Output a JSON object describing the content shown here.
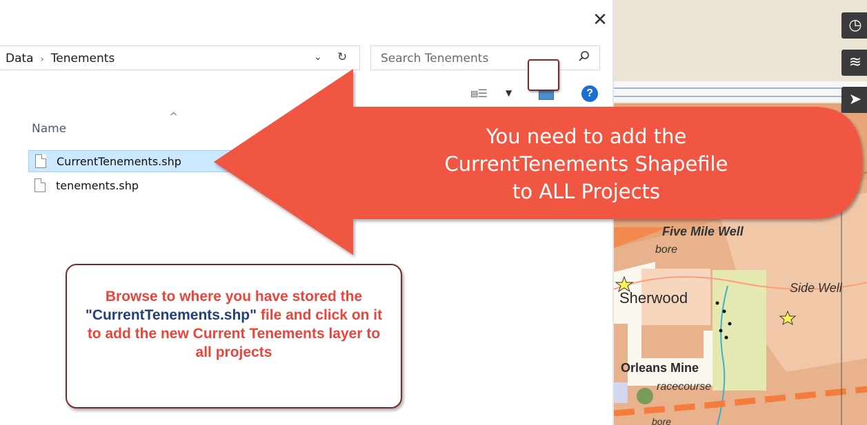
{
  "dialog": {
    "close_glyph": "✕",
    "breadcrumb": {
      "items": [
        "Data",
        "Tenements"
      ],
      "separator": "›"
    },
    "address_dropdown_icon": "chevron-down-icon",
    "refresh_icon": "refresh-icon",
    "search": {
      "placeholder": "Search Tenements",
      "value": "",
      "icon": "search-icon"
    },
    "toolbar": {
      "view_icon": "view-list-icon",
      "help_glyph": "?"
    },
    "column_header": "Name",
    "files": [
      {
        "name": "CurrentTenements.shp",
        "selected": true
      },
      {
        "name": "tenements.shp",
        "selected": false
      }
    ]
  },
  "callouts": {
    "arrow_lines": [
      "You need to add  the",
      "CurrentTenements Shapefile",
      "to ALL Projects"
    ],
    "arrow_color": "#f05643",
    "box": {
      "part1": "Browse to where you have stored the ",
      "highlight": "\"CurrentTenements.shp\"",
      "part2": " file and click on it to add the new Current Tenements layer to all projects"
    },
    "box_text_color": "#e8453c",
    "box_highlight_color": "#24407a"
  },
  "map": {
    "labels": {
      "five_mile_well": "Five Mile Well",
      "bore1": "bore",
      "side_well": "Side Well",
      "sherwood": "Sherwood",
      "orleans_mine": "Orleans Mine",
      "racecourse": "racecourse",
      "bore2": "bore"
    },
    "buttons": [
      "clock-icon",
      "layers-icon",
      "send-icon"
    ]
  }
}
